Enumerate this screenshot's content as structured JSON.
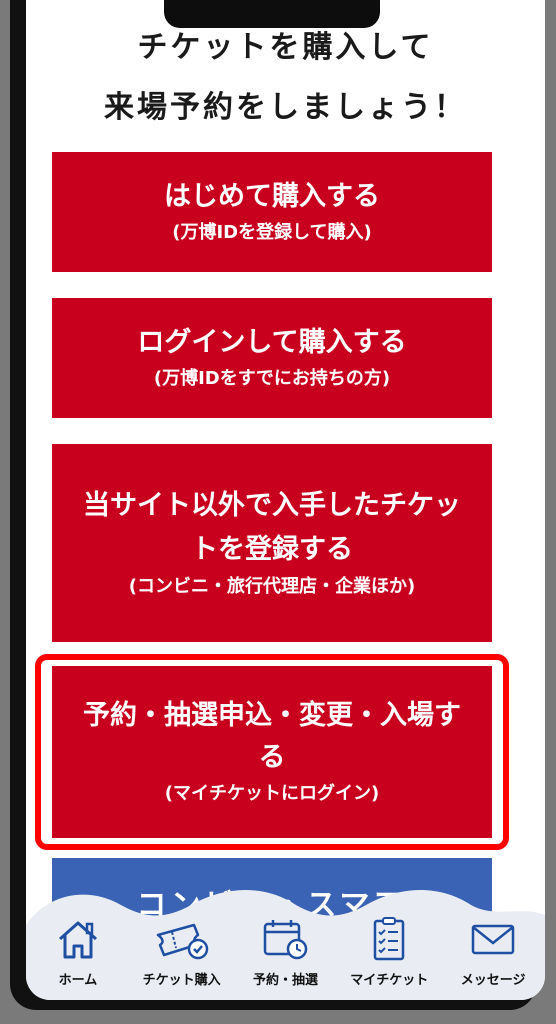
{
  "header": {
    "line1": "チケットを購入して",
    "line2": "来場予約をしましょう！"
  },
  "buttons": [
    {
      "main": "はじめて購入する",
      "sub": "(万博IDを登録して購入)"
    },
    {
      "main": "ログインして購入する",
      "sub": "(万博IDをすでにお持ちの方)"
    },
    {
      "main": "当サイト以外で入手したチケットを登録する",
      "sub": "(コンビニ・旅行代理店・企業ほか)"
    },
    {
      "main": "予約・抽選申込・変更・入場する",
      "sub": "(マイチケットにログイン)"
    }
  ],
  "partial_button": {
    "label": "コンビニ・スマア"
  },
  "tabbar": {
    "items": [
      {
        "label": "ホーム",
        "icon": "home-icon"
      },
      {
        "label": "チケット購入",
        "icon": "ticket-icon"
      },
      {
        "label": "予約・抽選",
        "icon": "calendar-icon"
      },
      {
        "label": "マイチケット",
        "icon": "clipboard-icon"
      },
      {
        "label": "メッセージ",
        "icon": "mail-icon"
      }
    ]
  },
  "colors": {
    "button_red": "#c8001e",
    "highlight": "#ff0000",
    "accent_blue": "#3a62b5",
    "icon_blue": "#1f4fa3"
  }
}
